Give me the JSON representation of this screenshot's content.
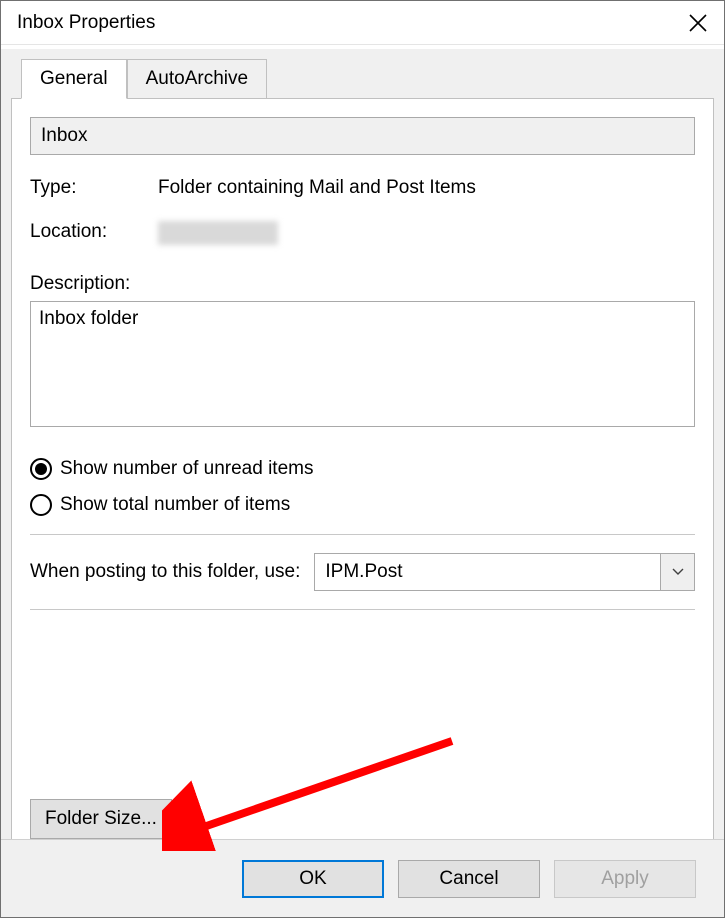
{
  "title": "Inbox Properties",
  "tabs": {
    "general": "General",
    "autoarchive": "AutoArchive"
  },
  "folder_name": "Inbox",
  "labels": {
    "type": "Type:",
    "location": "Location:",
    "description": "Description:",
    "posting": "When posting to this folder, use:"
  },
  "values": {
    "type": "Folder containing Mail and Post Items",
    "description": "Inbox folder",
    "posting_selected": "IPM.Post"
  },
  "radio": {
    "unread": "Show number of unread items",
    "total": "Show total number of items",
    "selected": "unread"
  },
  "buttons": {
    "folder_size": "Folder Size...",
    "ok": "OK",
    "cancel": "Cancel",
    "apply": "Apply"
  }
}
